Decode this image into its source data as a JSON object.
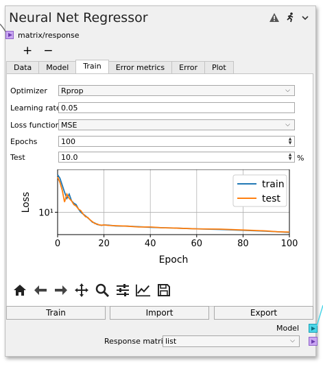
{
  "window": {
    "title": "Neural Net Regressor"
  },
  "input_port": {
    "label": "matrix/response"
  },
  "add_remove": {
    "plus": "+",
    "minus": "−"
  },
  "tabs": [
    {
      "label": "Data",
      "active": false
    },
    {
      "label": "Model",
      "active": false
    },
    {
      "label": "Train",
      "active": true
    },
    {
      "label": "Error metrics",
      "active": false
    },
    {
      "label": "Error",
      "active": false
    },
    {
      "label": "Plot",
      "active": false
    }
  ],
  "settings": {
    "optimizer": {
      "label": "Optimizer",
      "value": "Rprop"
    },
    "learning_rate": {
      "label": "Learning rate",
      "value": "0.05"
    },
    "loss_function": {
      "label": "Loss function",
      "value": "MSE"
    },
    "epochs": {
      "label": "Epochs",
      "value": "100"
    },
    "test": {
      "label": "Test",
      "value": "10.0",
      "unit": "%"
    }
  },
  "chart_data": {
    "type": "line",
    "xlabel": "Epoch",
    "ylabel": "Loss",
    "ylog": true,
    "xlim": [
      0,
      100
    ],
    "ylim": [
      5.2,
      35
    ],
    "xticks": [
      0,
      20,
      40,
      60,
      80,
      100
    ],
    "ytick_label": "10¹",
    "grid": true,
    "legend": "top-right",
    "series": [
      {
        "name": "train",
        "color": "#1f77b4",
        "x": [
          0,
          1,
          2,
          3,
          4,
          5,
          6,
          7,
          8,
          9,
          10,
          11,
          12,
          13,
          14,
          15,
          16,
          17,
          18,
          19,
          20,
          22,
          25,
          30,
          35,
          40,
          45,
          50,
          60,
          70,
          80,
          90,
          95,
          100
        ],
        "y": [
          30,
          27,
          22,
          18,
          15,
          17,
          14,
          13,
          12.5,
          11,
          10,
          9.5,
          9,
          8.5,
          8,
          7.5,
          7.3,
          7,
          6.9,
          6.8,
          6.9,
          6.85,
          6.7,
          6.65,
          6.55,
          6.45,
          6.35,
          6.3,
          6.15,
          6.05,
          5.9,
          5.75,
          5.65,
          5.55
        ]
      },
      {
        "name": "test",
        "color": "#ff7f0e",
        "x": [
          0,
          1,
          2,
          3,
          4,
          5,
          6,
          7,
          8,
          9,
          10,
          11,
          12,
          13,
          14,
          15,
          16,
          17,
          18,
          19,
          20,
          22,
          25,
          30,
          35,
          40,
          45,
          50,
          60,
          70,
          80,
          90,
          95,
          100
        ],
        "y": [
          28,
          24,
          19,
          13.5,
          17,
          15,
          14,
          12.5,
          12,
          11,
          10.5,
          9.5,
          8.8,
          8.6,
          8,
          7.6,
          7.2,
          7.1,
          6.9,
          6.85,
          6.9,
          6.8,
          6.75,
          6.65,
          6.5,
          6.5,
          6.35,
          6.3,
          6.15,
          6.1,
          5.95,
          5.8,
          5.65,
          5.6
        ]
      }
    ]
  },
  "toolbar_icons": [
    "home-icon",
    "back-icon",
    "forward-icon",
    "pan-icon",
    "zoom-icon",
    "configure-icon",
    "edit-axes-icon",
    "save-icon"
  ],
  "buttons": {
    "train": "Train",
    "import": "Import",
    "export": "Export"
  },
  "outputs": {
    "model_label": "Model",
    "response_label": "Response matrix",
    "response_value": "list"
  },
  "colors": {
    "input_port": "#c9a6f2",
    "model_port": "#4cd6e8",
    "train": "#1f77b4",
    "test": "#ff7f0e"
  }
}
